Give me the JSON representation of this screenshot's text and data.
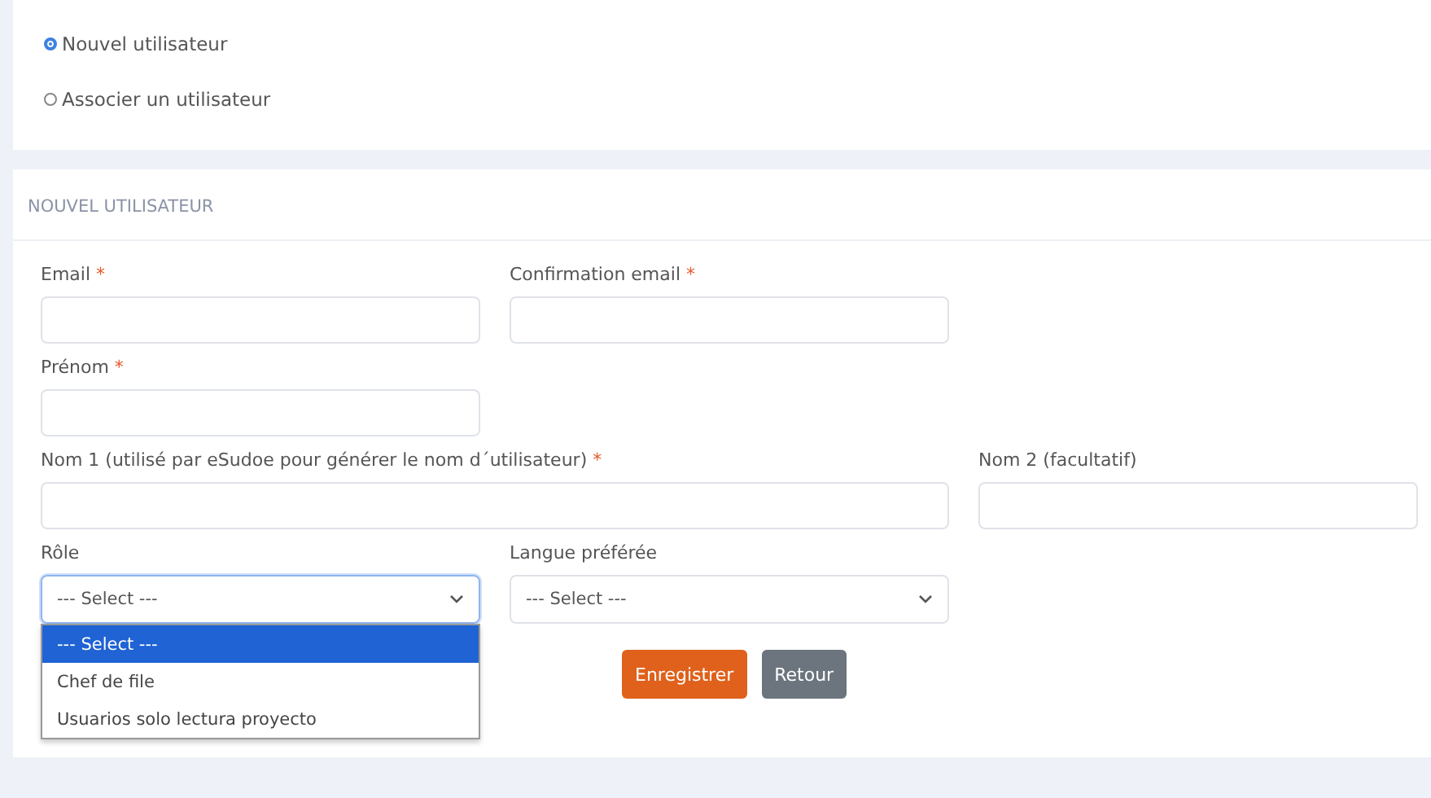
{
  "mode_options": [
    {
      "label": "Nouvel utilisateur",
      "selected": true
    },
    {
      "label": "Associer un utilisateur",
      "selected": false
    }
  ],
  "section": {
    "title": "NOUVEL UTILISATEUR"
  },
  "fields": [
    {
      "kind": "input",
      "label": "Email",
      "mark": "*"
    },
    {
      "kind": "input",
      "label": "Confirmation email",
      "mark": "*"
    },
    {
      "kind": "break"
    },
    {
      "kind": "input",
      "label": "Prénom",
      "mark": "*"
    },
    {
      "kind": "break"
    },
    {
      "kind": "wide_input",
      "label": "Nom 1 (utilisé par eSudoe pour générer le nom d´utilisateur)",
      "mark": "*"
    },
    {
      "kind": "input",
      "label": "Nom 2 (facultatif)"
    },
    {
      "kind": "select",
      "label": "Rôle",
      "value": "--- Select ---",
      "expanded": true,
      "options": [
        {
          "label": "--- Select ---",
          "selected": true
        },
        {
          "label": "Chef de file",
          "selected": false
        },
        {
          "label": "Usuarios solo lectura proyecto",
          "selected": false
        }
      ]
    },
    {
      "kind": "select",
      "label": "Langue préférée",
      "value": "--- Select ---",
      "expanded": false
    }
  ],
  "buttons": [
    {
      "label": "Enregistrer",
      "kind": "primary"
    },
    {
      "label": "Retour",
      "kind": "secondary"
    }
  ]
}
